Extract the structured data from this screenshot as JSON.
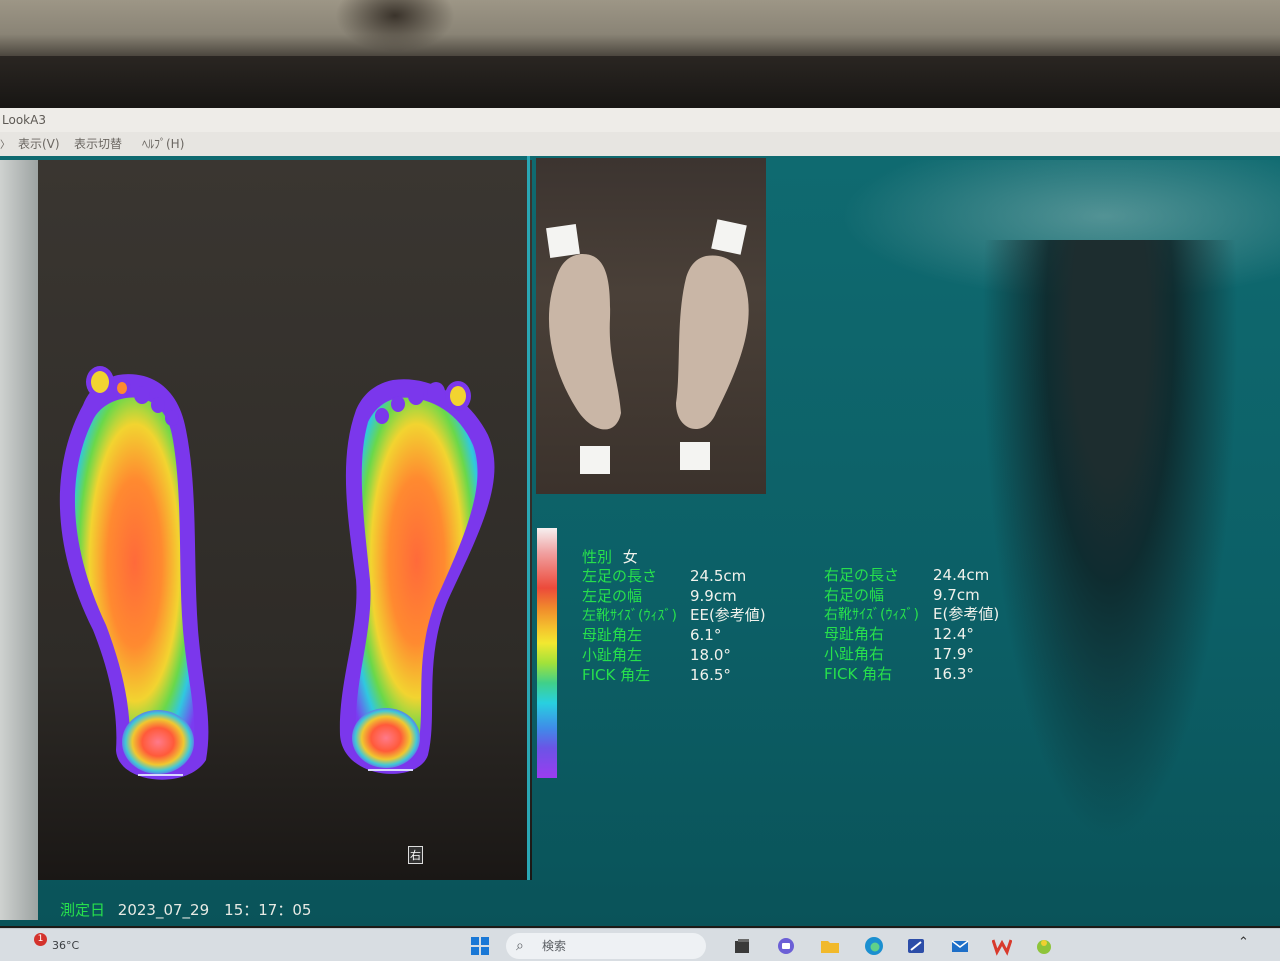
{
  "window": {
    "title": "LookA3",
    "menu": [
      "表示(V)",
      "表示切替",
      "ﾍﾙﾌﾟ(H)"
    ]
  },
  "measurement": {
    "gender_label": "性別",
    "gender_value": "女",
    "left": [
      {
        "label": "左足の長さ",
        "value": "24.5cm"
      },
      {
        "label": "左足の幅",
        "value": "9.9cm"
      },
      {
        "label": "左靴ｻｲｽﾞ(ｳｨｽﾞ)",
        "value": "EE(参考値)"
      },
      {
        "label": "母趾角左",
        "value": "6.1°"
      },
      {
        "label": "小趾角左",
        "value": "18.0°"
      },
      {
        "label": "FICK 角左",
        "value": "16.5°"
      }
    ],
    "right": [
      {
        "label": "右足の長さ",
        "value": "24.4cm"
      },
      {
        "label": "右足の幅",
        "value": "9.7cm"
      },
      {
        "label": "右靴ｻｲｽﾞ(ｳｨｽﾞ)",
        "value": "E(参考値)"
      },
      {
        "label": "母趾角右",
        "value": "12.4°"
      },
      {
        "label": "小趾角右",
        "value": "17.9°"
      },
      {
        "label": "FICK 角右",
        "value": "16.3°"
      }
    ],
    "date_label": "測定日",
    "date_value": "2023_07_29　15：17：05"
  },
  "scan": {
    "right_marker": "右"
  },
  "taskbar": {
    "weather": "36°C",
    "weather_badge": "1",
    "search_placeholder": "検索",
    "icons": [
      "windows-start",
      "search",
      "file-explorer-dark",
      "chat",
      "folder",
      "edge",
      "snipping-tool",
      "mail",
      "wps-office",
      "app"
    ]
  },
  "colors": {
    "label": "#27e04c",
    "value": "#f1f2ec",
    "background": "#0f6a70"
  }
}
